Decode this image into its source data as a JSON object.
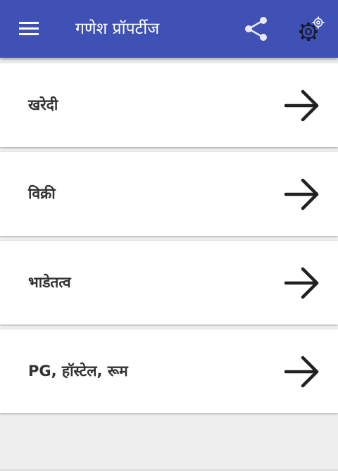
{
  "appbar": {
    "title": "गणेश प्रॉपर्टीज",
    "menu_icon": "menu-icon",
    "share_icon": "share-icon",
    "settings_icon": "settings-gear-icon",
    "bg_color": "#3f51b5"
  },
  "list": {
    "items": [
      {
        "label": "खरेदी",
        "icon": "arrow-right-icon"
      },
      {
        "label": "विक्री",
        "icon": "arrow-right-icon"
      },
      {
        "label": "भाडेतत्व",
        "icon": "arrow-right-icon"
      },
      {
        "label": "PG, हॉस्टेल, रूम",
        "icon": "arrow-right-icon"
      }
    ]
  }
}
